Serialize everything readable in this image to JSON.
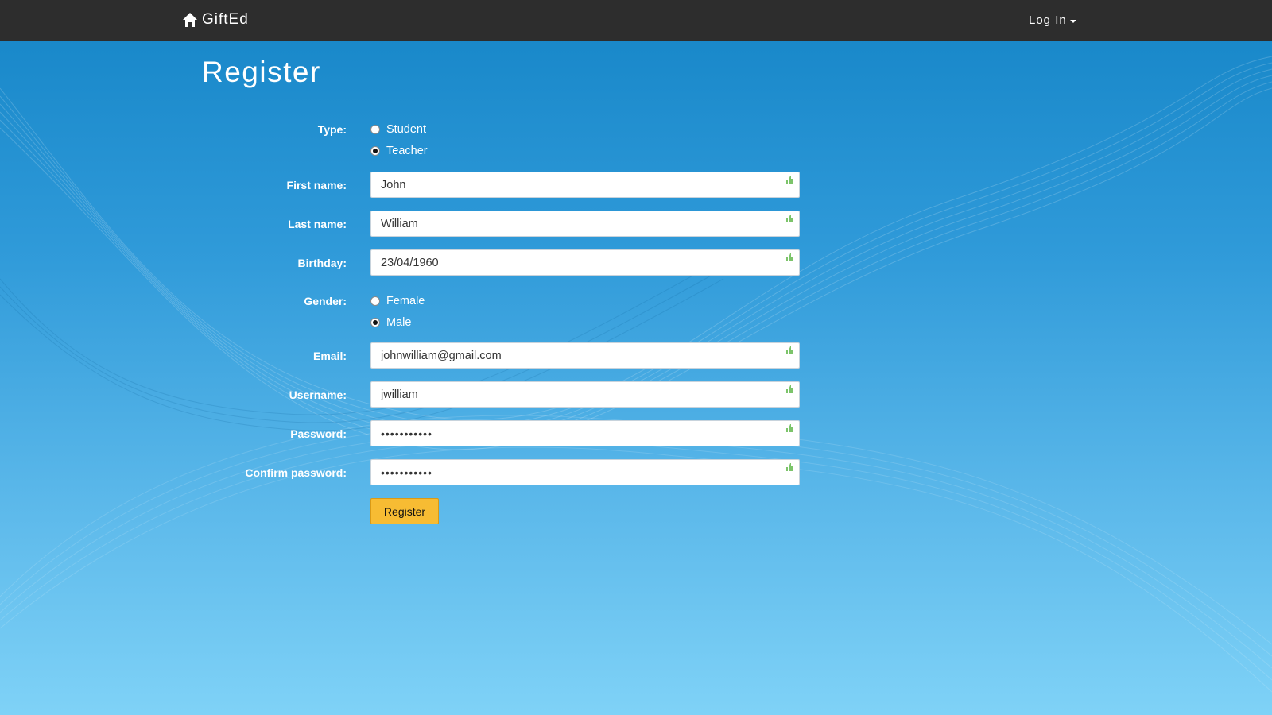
{
  "navbar": {
    "brand": "GiftEd",
    "brand_icon": "home-icon",
    "login_label": "Log In"
  },
  "page": {
    "title": "Register"
  },
  "form": {
    "type": {
      "label": "Type:",
      "options": [
        "Student",
        "Teacher"
      ],
      "selected": "Teacher"
    },
    "first_name": {
      "label": "First name:",
      "value": "John"
    },
    "last_name": {
      "label": "Last name:",
      "value": "William"
    },
    "birthday": {
      "label": "Birthday:",
      "value": "23/04/1960"
    },
    "gender": {
      "label": "Gender:",
      "options": [
        "Female",
        "Male"
      ],
      "selected": "Male"
    },
    "email": {
      "label": "Email:",
      "value": "johnwilliam@gmail.com"
    },
    "username": {
      "label": "Username:",
      "value": "jwilliam"
    },
    "password": {
      "label": "Password:",
      "value": "•••••••••••"
    },
    "confirm_password": {
      "label": "Confirm password:",
      "value": "•••••••••••"
    },
    "submit_label": "Register"
  },
  "colors": {
    "navbar": "#2d2d2d",
    "background_top": "#1585c7",
    "background_bottom": "#7fd2f7",
    "button": "#f7bc33",
    "validation_icon": "#7cc46a"
  },
  "icons": {
    "validation": "thumbs-up-icon"
  }
}
